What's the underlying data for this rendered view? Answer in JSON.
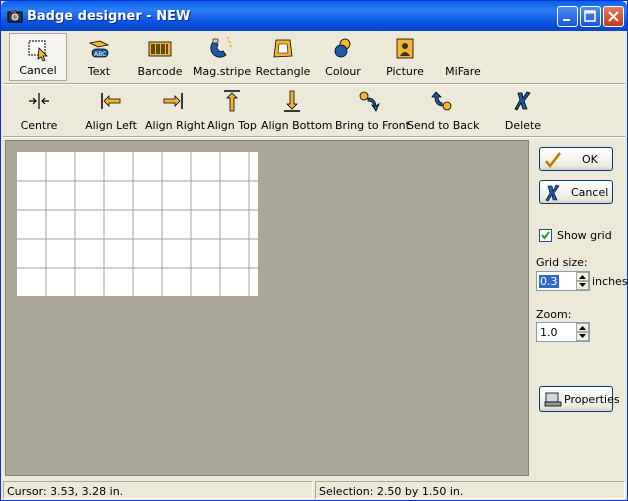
{
  "window": {
    "title": "Badge designer - NEW"
  },
  "toolbar_top": [
    {
      "id": "cancel",
      "label": "Cancel",
      "icon": "select-cancel-icon"
    },
    {
      "id": "text",
      "label": "Text",
      "icon": "text-icon"
    },
    {
      "id": "barcode",
      "label": "Barcode",
      "icon": "barcode-icon"
    },
    {
      "id": "magstripe",
      "label": "Mag.stripe",
      "icon": "magnet-icon"
    },
    {
      "id": "rectangle",
      "label": "Rectangle",
      "icon": "rectangle-icon"
    },
    {
      "id": "colour",
      "label": "Colour",
      "icon": "colour-icon"
    },
    {
      "id": "picture",
      "label": "Picture",
      "icon": "picture-icon"
    },
    {
      "id": "mifare",
      "label": "MiFare",
      "icon": "mifare-icon"
    }
  ],
  "toolbar_align": [
    {
      "id": "centre",
      "label": "Centre",
      "icon": "centre-icon"
    },
    {
      "id": "align_left",
      "label": "Align Left",
      "icon": "align-left-icon"
    },
    {
      "id": "align_right",
      "label": "Align Right",
      "icon": "align-right-icon"
    },
    {
      "id": "align_top",
      "label": "Align Top",
      "icon": "align-top-icon"
    },
    {
      "id": "align_bottom",
      "label": "Align Bottom",
      "icon": "align-bottom-icon"
    },
    {
      "id": "bring_front",
      "label": "Bring to Front",
      "icon": "bring-front-icon"
    },
    {
      "id": "send_back",
      "label": "Send to Back",
      "icon": "send-back-icon"
    },
    {
      "id": "delete",
      "label": "Delete",
      "icon": "delete-icon"
    }
  ],
  "panel": {
    "ok_label": "OK",
    "cancel_label": "Cancel",
    "show_grid_label": "Show grid",
    "show_grid_checked": true,
    "grid_size_label": "Grid size:",
    "grid_size_value": "0.3",
    "grid_size_unit": "inches",
    "zoom_label": "Zoom:",
    "zoom_value": "1.0",
    "properties_label": "Properties"
  },
  "status": {
    "cursor": "Cursor: 3.53, 3.28 in.",
    "selection": "Selection: 2.50 by 1.50 in."
  },
  "colors": {
    "canvas_bg": "#ACA899",
    "titlebar": "#0A54E0",
    "grid_line": "#A0A0A0"
  }
}
